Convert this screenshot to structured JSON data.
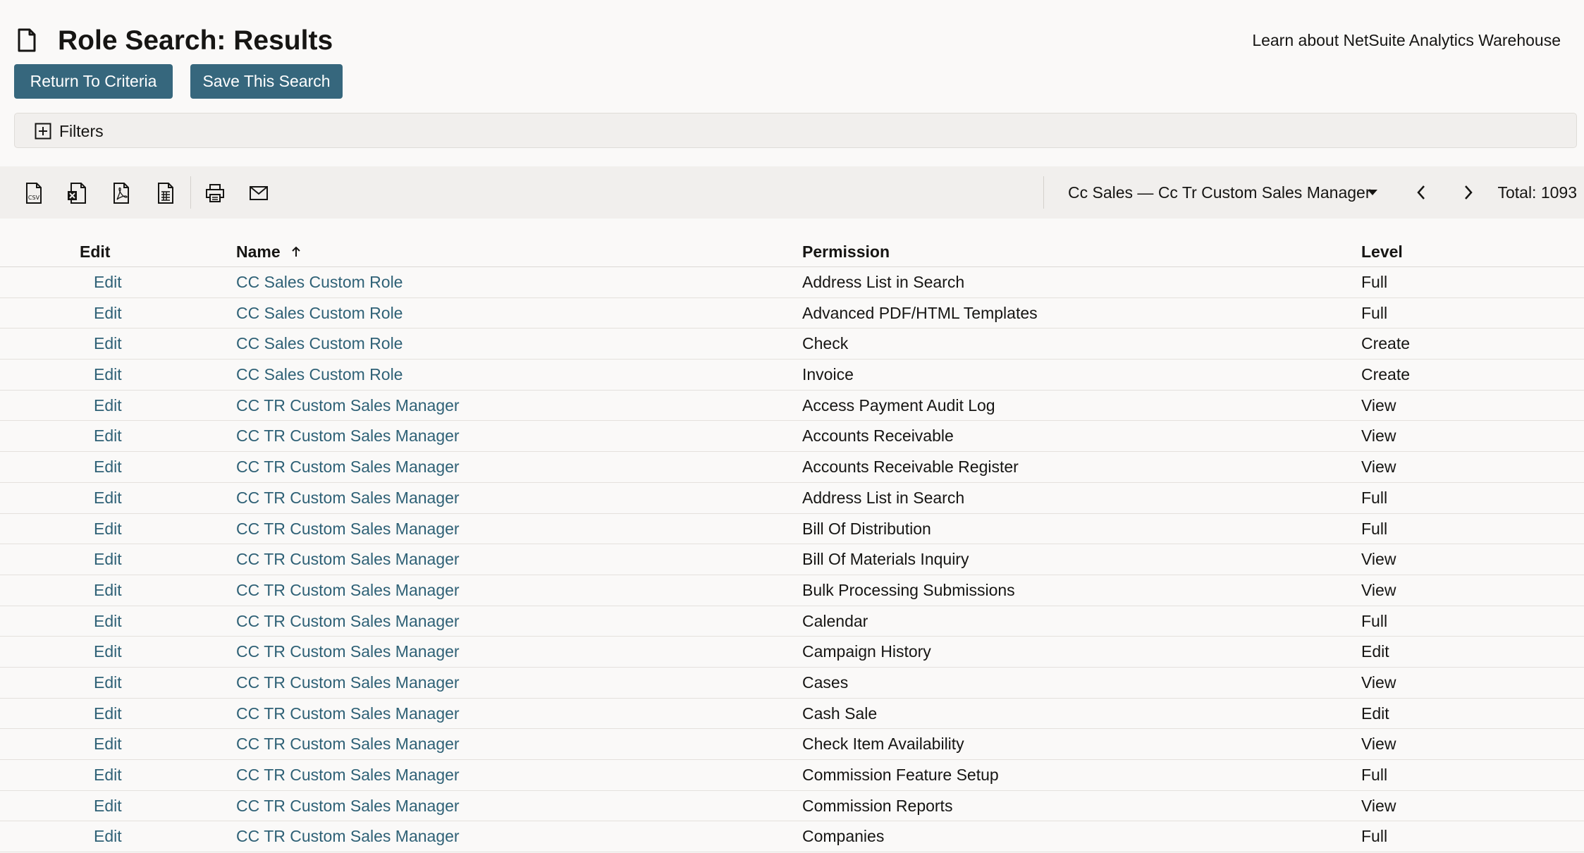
{
  "header": {
    "title": "Role Search: Results",
    "learn_link": "Learn about NetSuite Analytics Warehouse"
  },
  "buttons": {
    "return_label": "Return To Criteria",
    "save_label": "Save This Search"
  },
  "filters": {
    "label": "Filters"
  },
  "toolbar": {
    "icons": [
      "csv-export-icon",
      "excel-export-icon",
      "pdf-export-icon",
      "spreadsheet-export-icon",
      "print-icon",
      "email-icon"
    ],
    "selected_range": "Cc Sales — Cc Tr Custom Sales Manager",
    "total": "Total: 1093"
  },
  "table": {
    "columns": [
      "Edit",
      "Name",
      "Permission",
      "Level"
    ],
    "rows": [
      {
        "edit": "Edit",
        "name": "CC Sales Custom Role",
        "permission": "Address List in Search",
        "level": "Full"
      },
      {
        "edit": "Edit",
        "name": "CC Sales Custom Role",
        "permission": "Advanced PDF/HTML Templates",
        "level": "Full"
      },
      {
        "edit": "Edit",
        "name": "CC Sales Custom Role",
        "permission": "Check",
        "level": "Create"
      },
      {
        "edit": "Edit",
        "name": "CC Sales Custom Role",
        "permission": "Invoice",
        "level": "Create"
      },
      {
        "edit": "Edit",
        "name": "CC TR Custom Sales Manager",
        "permission": "Access Payment Audit Log",
        "level": "View"
      },
      {
        "edit": "Edit",
        "name": "CC TR Custom Sales Manager",
        "permission": "Accounts Receivable",
        "level": "View"
      },
      {
        "edit": "Edit",
        "name": "CC TR Custom Sales Manager",
        "permission": "Accounts Receivable Register",
        "level": "View"
      },
      {
        "edit": "Edit",
        "name": "CC TR Custom Sales Manager",
        "permission": "Address List in Search",
        "level": "Full"
      },
      {
        "edit": "Edit",
        "name": "CC TR Custom Sales Manager",
        "permission": "Bill Of Distribution",
        "level": "Full"
      },
      {
        "edit": "Edit",
        "name": "CC TR Custom Sales Manager",
        "permission": "Bill Of Materials Inquiry",
        "level": "View"
      },
      {
        "edit": "Edit",
        "name": "CC TR Custom Sales Manager",
        "permission": "Bulk Processing Submissions",
        "level": "View"
      },
      {
        "edit": "Edit",
        "name": "CC TR Custom Sales Manager",
        "permission": "Calendar",
        "level": "Full"
      },
      {
        "edit": "Edit",
        "name": "CC TR Custom Sales Manager",
        "permission": "Campaign History",
        "level": "Edit"
      },
      {
        "edit": "Edit",
        "name": "CC TR Custom Sales Manager",
        "permission": "Cases",
        "level": "View"
      },
      {
        "edit": "Edit",
        "name": "CC TR Custom Sales Manager",
        "permission": "Cash Sale",
        "level": "Edit"
      },
      {
        "edit": "Edit",
        "name": "CC TR Custom Sales Manager",
        "permission": "Check Item Availability",
        "level": "View"
      },
      {
        "edit": "Edit",
        "name": "CC TR Custom Sales Manager",
        "permission": "Commission Feature Setup",
        "level": "Full"
      },
      {
        "edit": "Edit",
        "name": "CC TR Custom Sales Manager",
        "permission": "Commission Reports",
        "level": "View"
      },
      {
        "edit": "Edit",
        "name": "CC TR Custom Sales Manager",
        "permission": "Companies",
        "level": "Full"
      }
    ]
  }
}
